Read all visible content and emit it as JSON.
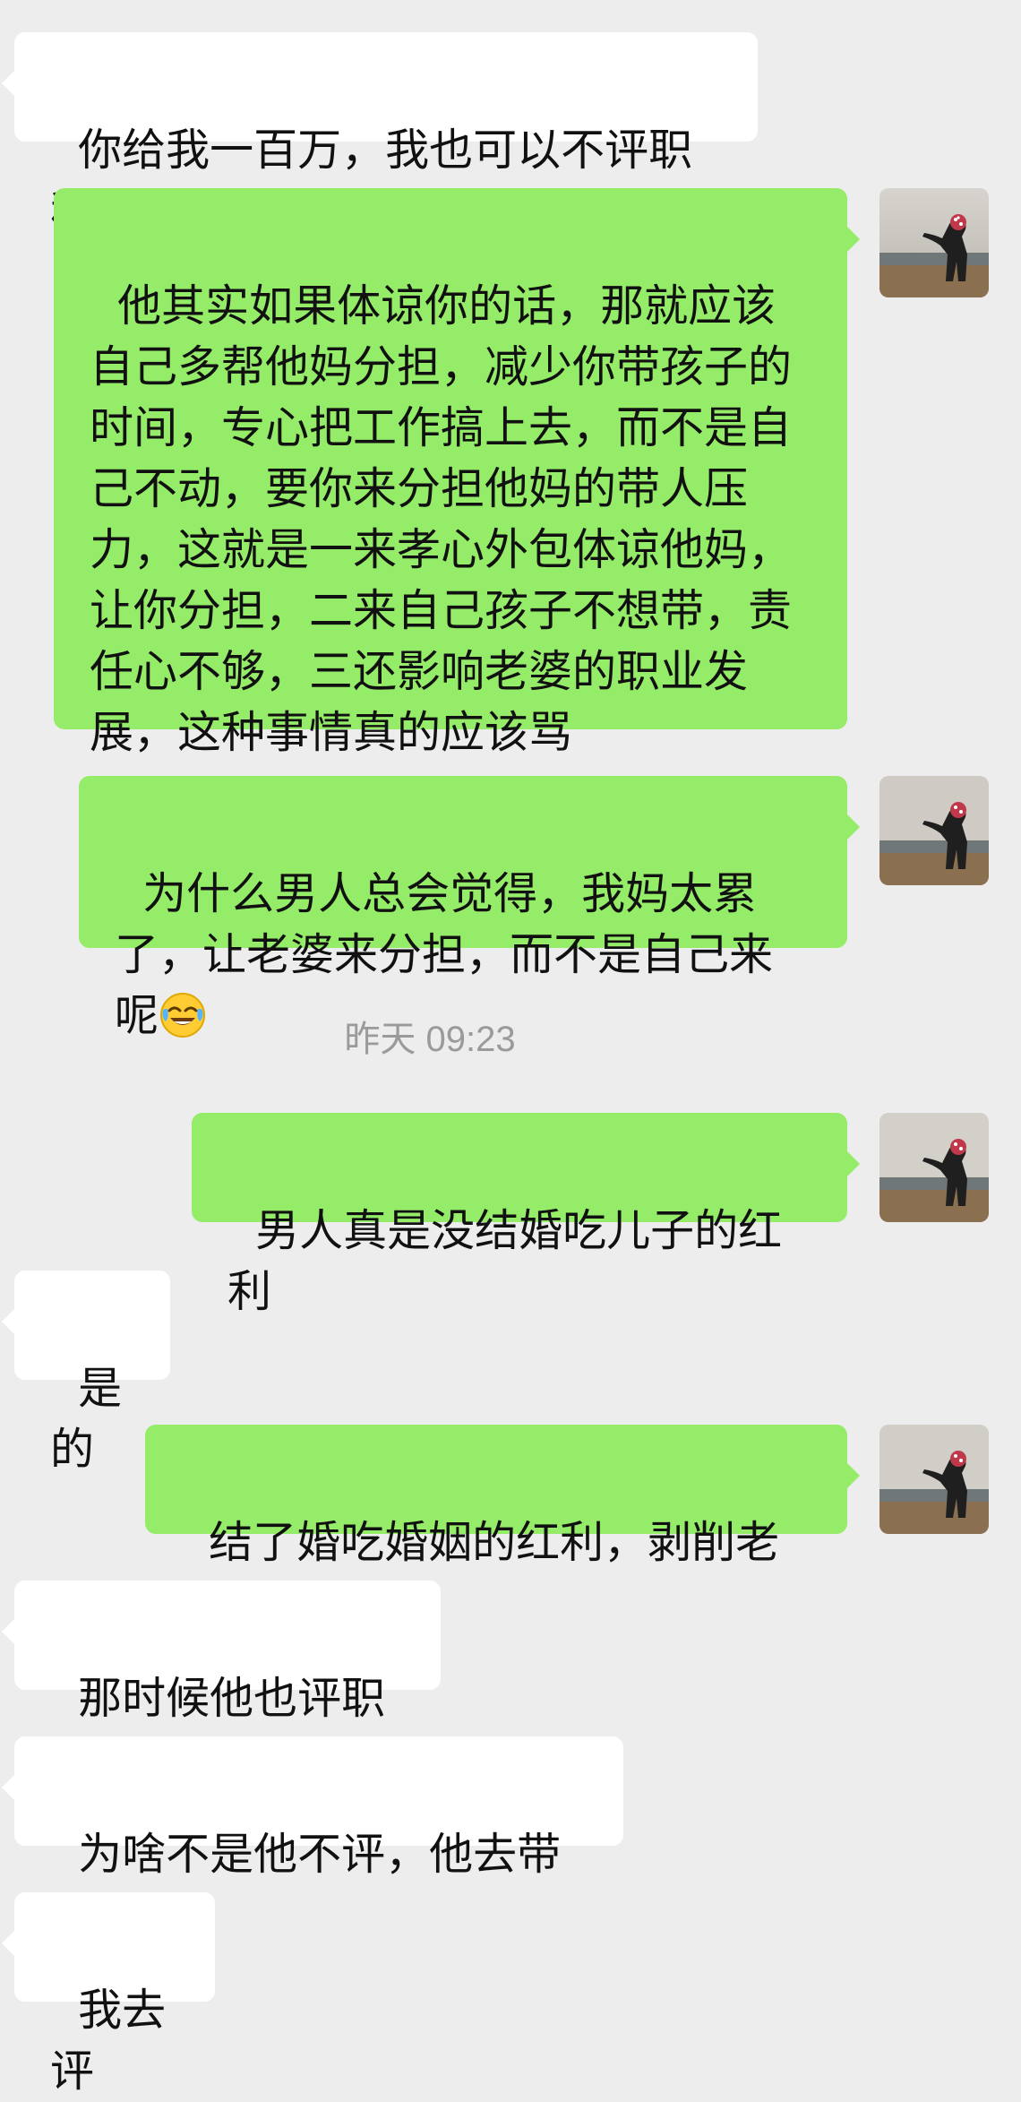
{
  "chat": {
    "messages": [
      {
        "side": "left",
        "text": "你给我一百万，我也可以不评职称"
      },
      {
        "side": "right",
        "text": "他其实如果体谅你的话，那就应该自己多帮他妈分担，减少你带孩子的时间，专心把工作搞上去，而不是自己不动，要你来分担他妈的带人压力，这就是一来孝心外包体谅他妈，让你分担，二来自己孩子不想带，责任心不够，三还影响老婆的职业发展，这种事情真的应该骂"
      },
      {
        "side": "right",
        "text": "为什么男人总会觉得，我妈太累了，让老婆来分担，而不是自己来呢",
        "emoji": "tears-of-joy-emoji"
      },
      {
        "side": "right",
        "text": "男人真是没结婚吃儿子的红利"
      },
      {
        "side": "left",
        "text": "是的"
      },
      {
        "side": "right",
        "text": "结了婚吃婚姻的红利，剥削老婆"
      },
      {
        "side": "left",
        "text": "那时候他也评职称"
      },
      {
        "side": "left",
        "text": "为啥不是他不评，他去带人"
      },
      {
        "side": "left",
        "text": "我去评"
      }
    ],
    "timestamp": "昨天 09:23"
  },
  "colors": {
    "background": "#ededed",
    "bubble_self": "#95ec69",
    "bubble_other": "#ffffff",
    "timestamp_text": "#9a9a9a"
  },
  "icons": {
    "avatar": "user-avatar-photo",
    "emoji": "tears-of-joy-emoji"
  }
}
